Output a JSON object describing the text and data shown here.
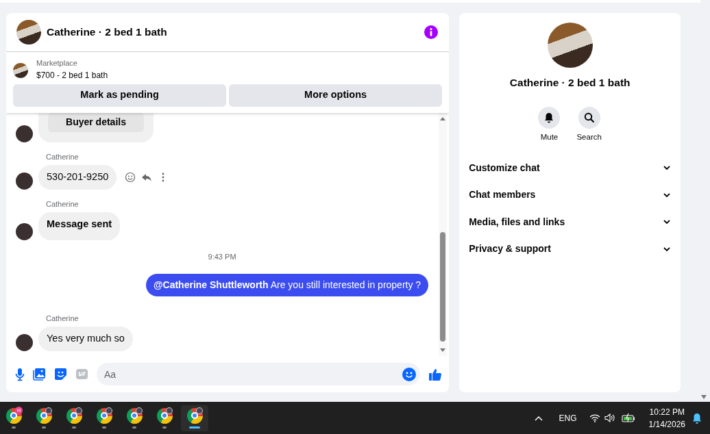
{
  "header": {
    "title": "Catherine · 2 bed 1 bath"
  },
  "listing": {
    "label": "Marketplace",
    "title": "$700 - 2 bed 1 bath",
    "buttons": [
      "Mark as pending",
      "More options"
    ]
  },
  "messages": [
    {
      "kind": "card",
      "label": "Buyer details"
    },
    {
      "kind": "incoming",
      "sender": "Catherine",
      "text": "530-201-9250",
      "bold": false,
      "hovered": true
    },
    {
      "kind": "incoming",
      "sender": "Catherine",
      "text": "Message sent",
      "bold": true,
      "hovered": false
    },
    {
      "kind": "timestamp",
      "text": "9:43 PM"
    },
    {
      "kind": "outgoing",
      "text": "**@Catherine Shuttleworth** Are you still interested in property ?"
    },
    {
      "kind": "incoming",
      "sender": "Catherine",
      "text": "Yes very much so",
      "bold": false,
      "hovered": false
    }
  ],
  "composer": {
    "placeholder": "Aa"
  },
  "details": {
    "title": "Catherine · 2 bed 1 bath",
    "actions": [
      {
        "kind": "mute",
        "label": "Mute"
      },
      {
        "kind": "search",
        "label": "Search"
      }
    ],
    "sections": [
      {
        "label": "Customize chat",
        "expanded": false
      },
      {
        "label": "Chat members",
        "expanded": false
      },
      {
        "label": "Media, files and links",
        "expanded": false
      },
      {
        "label": "Privacy & support",
        "expanded": false
      }
    ]
  },
  "taskbar": {
    "apps": [
      {
        "badge": "H",
        "selected": false
      },
      {
        "selected": false
      },
      {
        "selected": false
      },
      {
        "selected": false
      },
      {
        "selected": false
      },
      {
        "selected": false
      },
      {
        "selected": true
      }
    ],
    "language": "ENG",
    "time": "10:22 PM",
    "date": "1/14/2026"
  }
}
